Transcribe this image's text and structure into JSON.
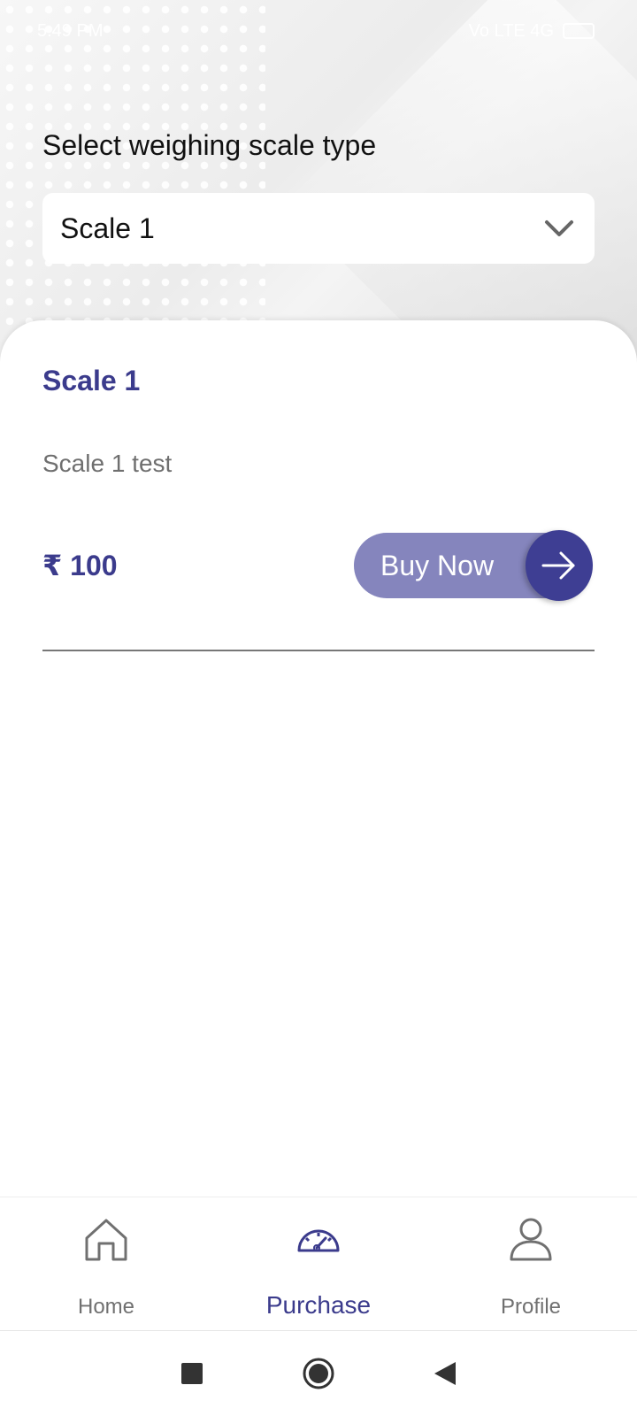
{
  "status_bar": {
    "time": "5:49 PM",
    "right_text": "Vo LTE 4G"
  },
  "selector": {
    "label": "Select weighing scale type",
    "selected_value": "Scale 1"
  },
  "product": {
    "title": "Scale 1",
    "description": "Scale 1 test",
    "price": "₹ 100",
    "buy_label": "Buy Now"
  },
  "bottom_nav": {
    "items": [
      {
        "label": "Home",
        "icon": "home-icon",
        "active": false
      },
      {
        "label": "Purchase",
        "icon": "speedometer-icon",
        "active": true
      },
      {
        "label": "Profile",
        "icon": "user-icon",
        "active": false
      }
    ]
  },
  "colors": {
    "primary": "#3b3b8c",
    "button": "#8585bd",
    "text_muted": "#6f6f6f"
  }
}
